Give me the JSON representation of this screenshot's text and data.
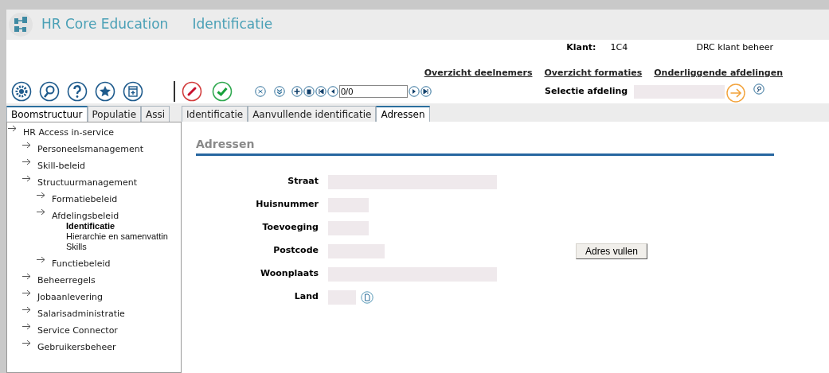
{
  "window": {
    "app_title": "HR Core Education",
    "page_title": "Identificatie"
  },
  "header": {
    "client_label": "Klant:",
    "client_code": "1C4",
    "client_name": "DRC klant beheer",
    "links": [
      "Overzicht deelnemers",
      "Overzicht formaties",
      "Onderliggende afdelingen"
    ],
    "record_counter": "0/0",
    "selection_label": "Selectie afdeling"
  },
  "left_tabs": [
    {
      "label": "Boomstructuur",
      "selected": true
    },
    {
      "label": "Populatie",
      "selected": false
    },
    {
      "label": "Assi",
      "selected": false
    }
  ],
  "tree": [
    {
      "label": "HR Access in-service",
      "kind": "branch",
      "selected": false,
      "children": [
        {
          "label": "Personeelsmanagement",
          "kind": "branch",
          "selected": false
        },
        {
          "label": "Skill-beleid",
          "kind": "branch",
          "selected": false
        },
        {
          "label": "Structuurmanagement",
          "kind": "branch",
          "selected": false,
          "children": [
            {
              "label": "Formatiebeleid",
              "kind": "branch",
              "selected": false
            },
            {
              "label": "Afdelingsbeleid",
              "kind": "branch",
              "selected": false,
              "children": [
                {
                  "label": "Identificatie",
                  "kind": "leaf",
                  "selected": true
                },
                {
                  "label": "Hierarchie en samenvattin",
                  "kind": "leaf",
                  "selected": false
                },
                {
                  "label": "Skills",
                  "kind": "leaf",
                  "selected": false
                }
              ]
            },
            {
              "label": "Functiebeleid",
              "kind": "branch",
              "selected": false
            }
          ]
        },
        {
          "label": "Beheerregels",
          "kind": "branch",
          "selected": false
        },
        {
          "label": "Jobaanlevering",
          "kind": "branch",
          "selected": false
        },
        {
          "label": "Salarisadministratie",
          "kind": "branch",
          "selected": false
        },
        {
          "label": "Service Connector",
          "kind": "branch",
          "selected": false
        },
        {
          "label": "Gebruikersbeheer",
          "kind": "branch",
          "selected": false
        }
      ]
    }
  ],
  "right_tabs": [
    {
      "label": "Identificatie",
      "selected": false
    },
    {
      "label": "Aanvullende identificatie",
      "selected": false
    },
    {
      "label": "Adressen",
      "selected": true
    }
  ],
  "section_title": "Adressen",
  "fields": [
    {
      "label": "Straat",
      "kind": "long"
    },
    {
      "label": "Huisnummer",
      "kind": "short"
    },
    {
      "label": "Toevoeging",
      "kind": "short"
    },
    {
      "label": "Postcode",
      "kind": "medium",
      "button": "Adres vullen"
    },
    {
      "label": "Woonplaats",
      "kind": "long"
    },
    {
      "label": "Land",
      "kind": "lookup"
    }
  ]
}
